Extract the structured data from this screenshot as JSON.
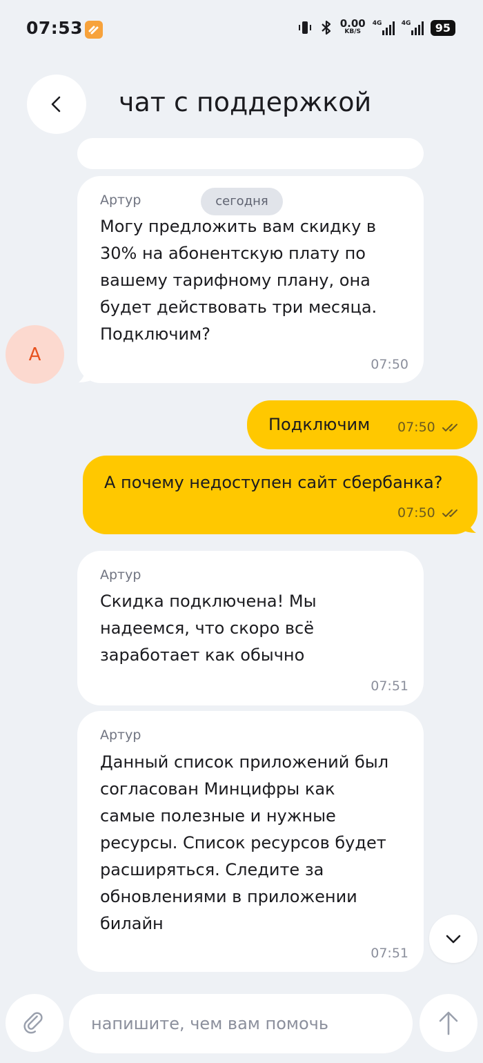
{
  "status_bar": {
    "time": "07:53",
    "net_speed_value": "0.00",
    "net_speed_unit": "KB/S",
    "network_1": "4G",
    "network_2": "4G",
    "battery": "95"
  },
  "header": {
    "title": "чат с поддержкой"
  },
  "date_chip": "сегодня",
  "avatar_letter": "А",
  "messages": [
    {
      "direction": "incoming",
      "sender": "Артур",
      "lines": [
        "Могу предложить вам скидку в",
        "30% на абонентскую плату по",
        "вашему тарифному плану, она",
        "будет действовать три месяца.",
        "Подключим?"
      ],
      "time": "07:50"
    },
    {
      "direction": "outgoing",
      "text": "Подключим",
      "time": "07:50",
      "status": "read"
    },
    {
      "direction": "outgoing",
      "text": "А почему недоступен сайт сбербанка?",
      "time": "07:50",
      "status": "read"
    },
    {
      "direction": "incoming",
      "sender": "Артур",
      "lines": [
        "Скидка подключена! Мы",
        "надеемся, что скоро всё",
        "заработает как обычно"
      ],
      "time": "07:51"
    },
    {
      "direction": "incoming",
      "sender": "Артур",
      "lines": [
        "Данный список приложений был",
        "согласован Минцифры как",
        "самые полезные и нужные",
        "ресурсы. Список ресурсов будет",
        "расширяться. Следите за",
        "обновлениями в приложении",
        "билайн"
      ],
      "time": "07:51"
    }
  ],
  "input": {
    "placeholder": "напишите, чем вам помочь"
  },
  "icons": {
    "back": "chevron-left-icon",
    "scroll_down": "chevron-down-icon",
    "attach": "paperclip-icon",
    "send": "arrow-up-icon",
    "read_status": "double-check-icon"
  },
  "colors": {
    "background": "#eef1f5",
    "incoming_bubble": "#ffffff",
    "outgoing_bubble": "#ffc800",
    "avatar_bg": "#fcd9cf",
    "avatar_text": "#e8521f"
  }
}
